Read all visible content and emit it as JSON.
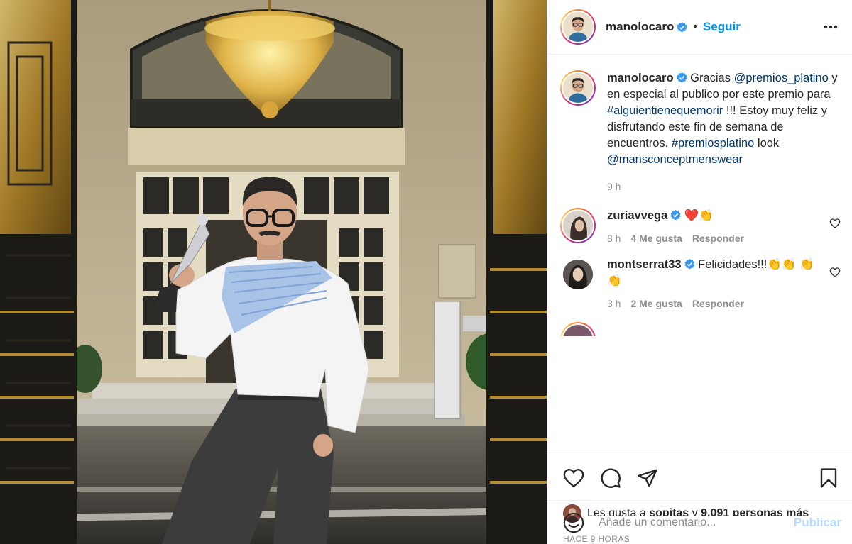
{
  "header": {
    "username": "manolocaro",
    "dot": "•",
    "follow_label": "Seguir"
  },
  "caption": {
    "username": "manolocaro",
    "text_1": "Gracias",
    "mention_1": "@premios_platino",
    "text_2": "y en especial al publico por este premio para",
    "hashtag_1": "#alguientienequemorir",
    "text_3": "!!! Estoy muy feliz y disfrutando este fin de semana de encuentros.",
    "hashtag_2": "#premiosplatino",
    "text_4": "look",
    "mention_2": "@mansconceptmenswear",
    "time": "9 h"
  },
  "comments": [
    {
      "username": "zuriavvega",
      "text": "❤️👏",
      "time": "8 h",
      "likes": "4 Me gusta",
      "reply": "Responder"
    },
    {
      "username": "montserrat33",
      "text": "Felicidades!!!👏👏 👏👏",
      "time": "3 h",
      "likes": "2 Me gusta",
      "reply": "Responder"
    }
  ],
  "likes": {
    "prefix": "Les gusta a",
    "user": "sopitas",
    "middle": "y",
    "count": "9.091 personas más"
  },
  "timestamp": "HACE 9 HORAS",
  "add_comment": {
    "placeholder": "Añade un comentario...",
    "publish_label": "Publicar"
  },
  "colors": {
    "link_blue": "#0095f6",
    "publish_disabled": "#b3dbff",
    "verified": "#3897f0",
    "heart_red": "#ed4956"
  },
  "icons": [
    "more-options-icon",
    "verified-badge-icon",
    "like-icon",
    "comment-icon",
    "share-icon",
    "save-icon",
    "emoji-icon",
    "comment-like-icon"
  ]
}
